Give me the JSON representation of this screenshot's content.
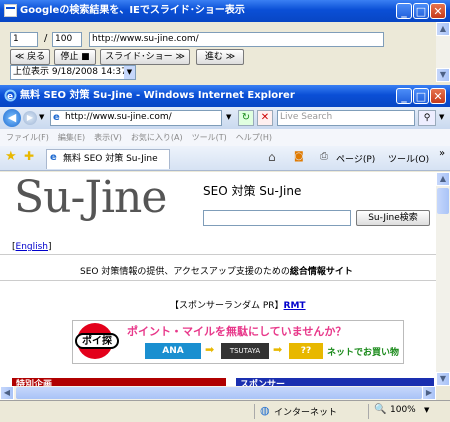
{
  "top_window": {
    "title": "Googleの検索結果を、IEでスライド･ショー表示",
    "current_index": "1",
    "separator": "/",
    "total": "100",
    "url": "http://www.su-jine.com/",
    "back_label": "≪ 戻る",
    "stop_label": "停止 ■",
    "slideshow_label": "スライド･ショー ≫",
    "next_label": "進む ≫",
    "display_select": "上位表示 9/18/2008 14:37"
  },
  "ie": {
    "title": "無料 SEO 対策 Su-Jine - Windows Internet Explorer",
    "address": "http://www.su-jine.com/",
    "search_placeholder": "Live Search",
    "menu": [
      "ファイル(F)",
      "編集(E)",
      "表示(V)",
      "お気に入り(A)",
      "ツール(T)",
      "ヘルプ(H)"
    ],
    "tab_label": "無料 SEO 対策 Su-Jine",
    "page_menu": "ページ(P)",
    "tools_menu": "ツール(O)",
    "more": "»",
    "status_zone": "インターネット",
    "zoom": "100%"
  },
  "page": {
    "logo": "Su-Jine",
    "heading": "SEO 対策 Su-Jine",
    "search_button": "Su-Jine検索",
    "english_link": "English",
    "tagline_pre": "SEO 対策情報の提供、アクセスアップ支援のための",
    "tagline_bold": "総合情報サイト",
    "sponsor_prefix": "【スポンサーランダム PR】",
    "sponsor_link": "RMT",
    "banner": {
      "logo_text": "ポイ探",
      "headline": "ポイント・マイルを無駄にしていませんか？",
      "ana": "ANA",
      "tsutaya": "TSUTAYA",
      "qq": "??",
      "tail": "ネットでお買い物"
    },
    "left_section": "特別企画",
    "right_section": "スポンサー"
  },
  "colors": {
    "xp_blue": "#0a4fd6",
    "banner_red": "#e8388a",
    "section_red": "#b00000",
    "section_blue": "#1a2fb0"
  }
}
